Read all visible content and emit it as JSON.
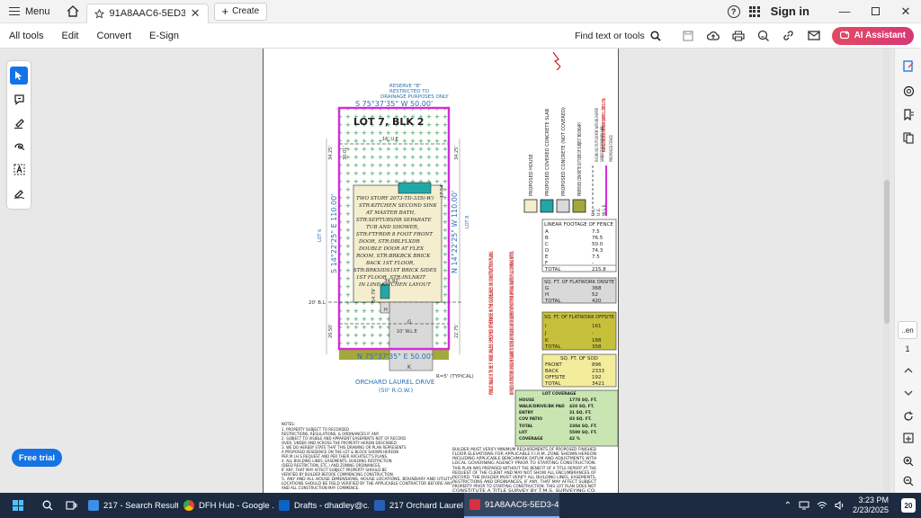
{
  "titlebar": {
    "menu_label": "Menu",
    "tab_title": "91A8AAC6-5ED3-41D5-8...",
    "tab_close": "✕",
    "create_label": "Create",
    "signin_label": "Sign in"
  },
  "toolbar": {
    "all_tools": "All tools",
    "edit": "Edit",
    "convert": "Convert",
    "esign": "E-Sign",
    "find_label": "Find text or tools",
    "ai_label": "AI Assistant"
  },
  "left_panel": {
    "free_trial": "Free trial"
  },
  "right_rail": {
    "page_box": "..en",
    "page_count": "1"
  },
  "plat": {
    "top_reserve": [
      "RESERVE \"B\"",
      "RESTRICTED TO",
      "DRAINAGE PURPOSES ONLY"
    ],
    "top_bearing": "S 75°37'35\" W 50.00'",
    "bottom_bearing": "N 75°37'35\" E 50.00'",
    "left_bearing": "S 14°22'25\" E 110.00'",
    "right_bearing": "N 14°22'25\" W 110.00'",
    "lot_label": "LOT 7, BLK 2",
    "ule_top": "16' U.E",
    "ule_bottom": "10' W.L.E",
    "bl_label": "20' B.L",
    "house_lines": [
      "TWO STORY 2073-TD-335(-W)",
      "STR:KITCHEN SECOND SINK",
      "AT MASTER BATH,",
      "STR:SEPTUBSHR SEPARATE",
      "TUB AND SHOWER,",
      "STR:FTFRDR 8 FOOT FRONT",
      "DOOR, STR:DBLFLXDR",
      "DOUBLE DOOR AT FLEX",
      "ROOM, STR:BRKBCK BRICK",
      "BACK 1ST FLOOR,",
      "STR:BRKSIDS1ST BRICK SIDES",
      "1ST FLOOR, STR:INLNKIT",
      "IN LINE KITCHEN LAYOUT"
    ],
    "dim_3492": "34.92'",
    "dim_54_79": "54.79'",
    "dim_20_50": "20.50'",
    "dim_22_75": "22.75'",
    "dim_34_25a": "34.25'",
    "dim_34_25b": "34.25'",
    "dim_30_01": "30.01'",
    "dim_17_54": "17.54'",
    "road_name": "ORCHARD LAUREL DRIVE",
    "road_row": "(50' R.O.W.)",
    "typical": "R=5' (TYPICAL)",
    "letter_g": "G",
    "letter_k": "K",
    "letter_h": "H",
    "lot_side_label": "LOT 6",
    "lot_side_label2": "LOT 8",
    "public_walk_note": "PUBLIC WALK IS TO BE 5' WIDE UNLESS SPECIFIED OTHERWISE IN THE GUIDELINES OR CONSTRUCTION PLANS.",
    "no_fence_note": "NO FENCES OR STRUCTURES SHOULD BE PLANNED TO EXCEED ANY BUILDING LINE OR EASEMENT WITHOUT PRIOR APPROVAL GRANTED BY ALL GOVERNING ENTITIES.",
    "top_note": "THIS LOT IS SUBJECT TO EASEMENTS AND BUILDING LINES NOT REFLECTED HEREON",
    "legend_items": [
      "PROPOSED HOUSE",
      "PROPOSED COVERED CONCRETE SLAB",
      "PROPOSED CONCRETE (NOT COVERED)",
      "PROPOSED CONCRETE OUTSIDE OF SUBJECT BOUNDARY",
      "BUILDING LINE, UTILITY EASEMENT, WATERLINE EASEMENT",
      "SUBJECT BOUNDARY LINE",
      "PROPOSED FENCE"
    ],
    "legend_abbr": [
      "B.L.",
      "U.E.",
      "W.L.E."
    ],
    "fence_table": {
      "title": "LINEAR FOOTAGE OF FENCE",
      "rows": [
        [
          "A",
          "7.5"
        ],
        [
          "B",
          "76.5"
        ],
        [
          "C",
          "50.0"
        ],
        [
          "D",
          "74.3"
        ],
        [
          "E",
          "7.5"
        ],
        [
          "F",
          "-"
        ]
      ],
      "total": [
        "TOTAL",
        "215.8"
      ]
    },
    "flatwork_onsite": {
      "title": "SQ. FT. OF FLATWORK ONSITE",
      "rows": [
        [
          "G",
          "368"
        ],
        [
          "H",
          "52"
        ]
      ],
      "total": [
        "TOTAL",
        "420"
      ]
    },
    "flatwork_offsite": {
      "title": "SQ. FT. OF FLATWORK OFFSITE",
      "rows": [
        [
          "I",
          "161"
        ],
        [
          "J",
          "-"
        ],
        [
          "K",
          "188"
        ]
      ],
      "total": [
        "TOTAL",
        "358"
      ]
    },
    "sod_table": {
      "title": "SQ. FT. OF SOD",
      "rows": [
        [
          "FRONT",
          "896"
        ],
        [
          "BACK",
          "2333"
        ],
        [
          "OFFSITE",
          "192"
        ]
      ],
      "total": [
        "TOTAL",
        "3421"
      ]
    },
    "coverage_table": {
      "title": "LOT COVERAGE",
      "rows": [
        [
          "HOUSE",
          "1778 SQ. FT."
        ],
        [
          "WALK/DRIVE/BK PAD",
          "420 SQ. FT."
        ],
        [
          "ENTRY",
          "31 SQ. FT."
        ],
        [
          "COV PATIO",
          "83 SQ. FT."
        ],
        [
          "TOTAL",
          "2304 SQ. FT."
        ],
        [
          "LOT",
          "5500 SQ. FT."
        ],
        [
          "COVERAGE",
          "42 %"
        ]
      ]
    },
    "notes_title": "NOTES:",
    "notes_lines": [
      "1. PROPERTY SUBJECT TO RECORDED",
      "RESTRICTIONS, REGULATIONS, & ORDINANCES IF ANY.",
      "2. SUBJECT TO VISIBLE AND APPARENT EASEMENTS NOT OF RECORD",
      "OVER, UNDER AND ACROSS THE PROPERTY HEREIN DESCRIBED.",
      "3. WE DO HEREBY STATE THAT THIS DRAWING OR PLAN REPRESENTS",
      "A PROPOSED RESIDENCE ON THE LOT & BLOCK SHOWN HEREON",
      "PER M.I.H.S REQUEST AND PER THEIR ARCHITECT'S PLANS.",
      "4. ALL BUILDING LINES, EASEMENTS, BUILDING RESTRICTION",
      "(DEED RESTRICTION, ETC.) AND ZONING ORDINANCES,",
      "IF ANY, THAT MAY AFFECT SUBJECT PROPERTY SHOULD BE",
      "VERIFIED BY BUILDER BEFORE COMMENCING CONSTRUCTION.",
      "5. ANY AND ALL HOUSE DIMENSIONS, HOUSE LOCATIONS, BOUNDARY AND UTILITY",
      "LOCATIONS SHOULD BE FIELD VERIFIED BY THE APPLICABLE CONTRACTOR BEFORE ANY",
      "AND ALL CONSTRUCTION MAY COMMENCE."
    ],
    "builder_note_lines": [
      "BUILDER MUST VERIFY MINIMUM REQUIREMENTS OF PROPOSED FINISHED",
      "FLOOR ELEVATIONS FOR APPLICABLE F.I.R.M. ZONE SHOWN HEREON",
      "INCLUDING APPLICABLE BENCHMARK DATUM AND ADJUSTMENTS WITH",
      "LOCAL GOVERNING AGENCY PRIOR TO STARTING CONSTRUCTION.",
      "THIS PLAN WAS PREPARED WITHOUT THE BENEFIT OF A TITLE REPORT AT THE",
      "REQUEST OF THE CLIENT AND MAY NOT SHOW ALL ENCUMBRANCES OF",
      "RECORD. THE BUILDER MUST VERIFY ALL BUILDING LINES, EASEMENTS,",
      "RESTRICTIONS AND ORDINANCES, IF ANY, THAT MAY AFFECT SUBJECT",
      "PROPERTY PRIOR TO STARTING CONSTRUCTION. THIS LOT PLAN DOES NOT",
      "CONSTITUTE A TITLE SURVEY BY T.M.S. SURVEYING CO."
    ]
  },
  "taskbar": {
    "tasks": [
      "217 - Search Result...",
      "DFH Hub - Google ...",
      "Drafts - dhadley@c...",
      "217 Orchard Laurel ...",
      "91A8AAC6-5ED3-4..."
    ],
    "time": "3:23 PM",
    "date": "2/23/2025",
    "notif_count": "20"
  },
  "colors": {
    "accent": "#1473e6",
    "boundary": "#d62ad9",
    "green_dot": "#1f9a3a",
    "teal": "#22a7a7",
    "olive": "#a3a83a",
    "yellow_table": "#f2ec9b",
    "coverage_green": "#c9e6b2"
  }
}
